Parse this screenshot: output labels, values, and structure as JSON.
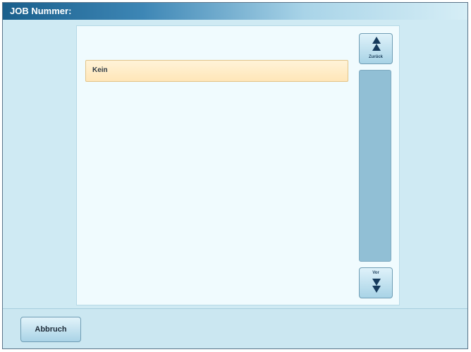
{
  "window": {
    "title": "JOB Nummer:"
  },
  "list": {
    "items": [
      {
        "label": "Kein",
        "selected": true
      }
    ]
  },
  "scroll": {
    "up_label": "Zurück",
    "down_label": "Vor"
  },
  "footer": {
    "cancel_label": "Abbruch"
  },
  "colors": {
    "title_bar": "#1a5f8c",
    "background": "#cfeaf3",
    "list_background": "#f0fbfe",
    "selected_item": "#ffe6b8",
    "scroll_track": "#91bfd5"
  },
  "icons": {
    "scroll_up": "arrow-up-icon",
    "scroll_down": "arrow-down-icon"
  }
}
